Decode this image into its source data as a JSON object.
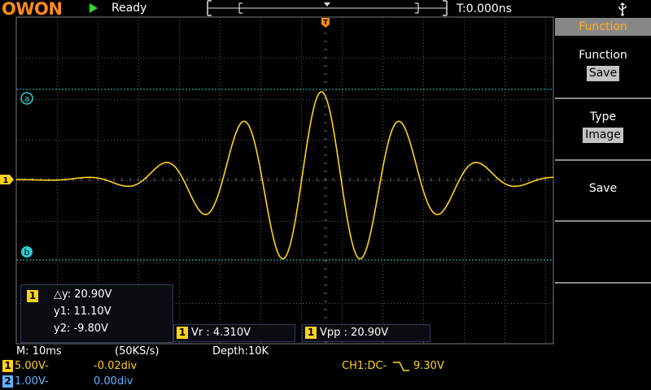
{
  "header": {
    "brand": "OWON",
    "run_state": "Ready",
    "trigger_time": "T:0.000ns"
  },
  "menu": {
    "title": "Function",
    "items": [
      {
        "label": "Function",
        "value": "Save"
      },
      {
        "label": "Type",
        "value": "Image"
      },
      {
        "label": "Save",
        "value": ""
      }
    ]
  },
  "cursor": {
    "channel": "1",
    "a_label": "a",
    "b_label": "b",
    "delta": "△y: 20.90V",
    "y1": "y1: 11.10V",
    "y2": "y2: -9.80V"
  },
  "measurements": [
    {
      "channel": "1",
      "text": "Vr : 4.310V"
    },
    {
      "channel": "1",
      "text": "Vpp : 20.90V"
    }
  ],
  "status": {
    "timebase": "M: 10ms",
    "sample_rate": "(50KS/s)",
    "depth": "Depth:10K",
    "ch1_badge": "1",
    "ch1_scale": "5.00V-",
    "ch1_offset": "-0.02div",
    "ch2_badge": "2",
    "ch2_scale": "1.00V-",
    "ch2_offset": "0.00div",
    "trigger": "CH1:DC-",
    "trigger_level": "9.30V"
  },
  "colors": {
    "trace": "#ffd21c",
    "cursor": "#2ad0d0",
    "grid": "#6e6e6e",
    "menu_header_text": "#ffb11c",
    "channel2": "#5fb3ff"
  },
  "icons": {
    "run": "play-icon",
    "usb": "usb-icon",
    "trigger_marker": "trigger-position-marker",
    "ch1_marker": "channel1-level-marker",
    "trigger_edge": "falling-edge-icon"
  }
}
